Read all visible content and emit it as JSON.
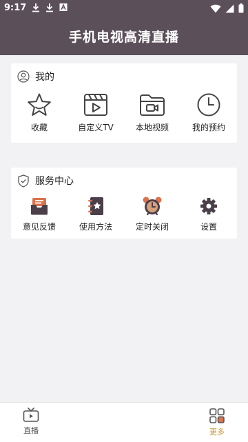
{
  "status_bar": {
    "time": "9:17",
    "icons": [
      "download-icon",
      "download-icon",
      "a-icon",
      "wifi-icon",
      "signal-icon",
      "battery-icon"
    ]
  },
  "header": {
    "title": "手机电视高清直播"
  },
  "mine": {
    "title": "我的",
    "items": [
      {
        "label": "收藏",
        "icon": "star-icon"
      },
      {
        "label": "自定义TV",
        "icon": "clapper-icon"
      },
      {
        "label": "本地视频",
        "icon": "folder-video-icon"
      },
      {
        "label": "我的预约",
        "icon": "clock-icon"
      }
    ]
  },
  "service": {
    "title": "服务中心",
    "items": [
      {
        "label": "意见反馈",
        "icon": "mailbox-icon"
      },
      {
        "label": "使用方法",
        "icon": "notebook-icon"
      },
      {
        "label": "定时关闭",
        "icon": "alarm-clock-icon"
      },
      {
        "label": "设置",
        "icon": "gear-icon"
      }
    ]
  },
  "bottom_nav": {
    "items": [
      {
        "label": "直播",
        "icon": "tv-icon",
        "active": false
      },
      {
        "label": "更多",
        "icon": "grid-icon",
        "active": true
      }
    ]
  },
  "colors": {
    "header": "#5b4f5a",
    "accent": "#c99a3a",
    "background": "#f2f2f4"
  }
}
